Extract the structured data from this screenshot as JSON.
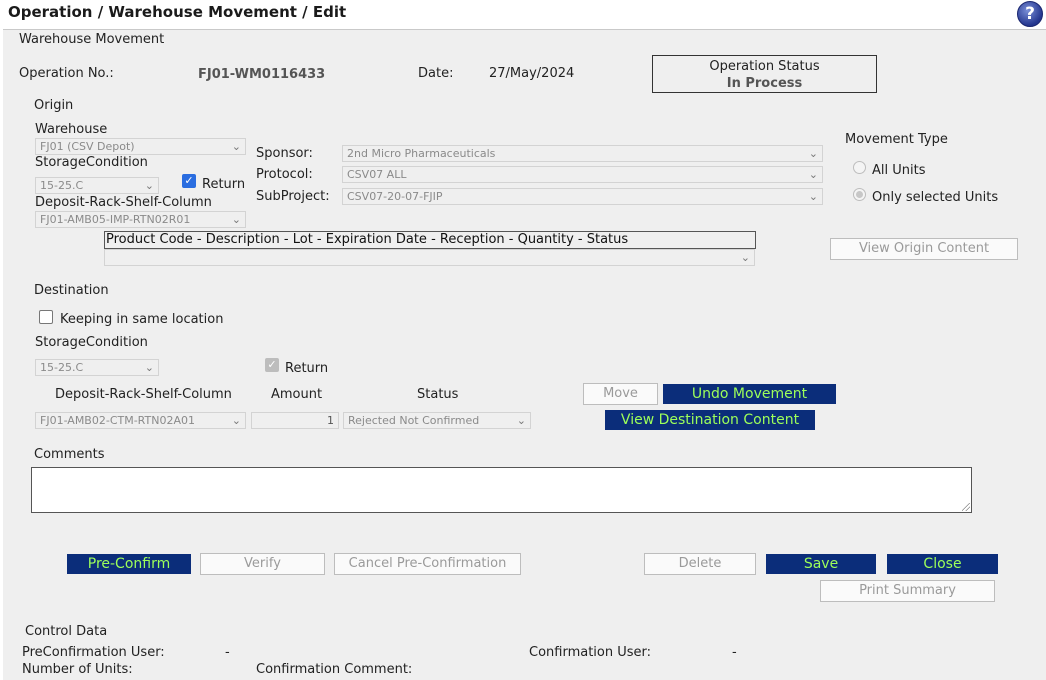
{
  "title": "Operation / Warehouse Movement / Edit",
  "section_title": "Warehouse Movement",
  "operation_no_label": "Operation No.:",
  "operation_no": "FJ01-WM0116433",
  "date_label": "Date:",
  "date": "27/May/2024",
  "status": {
    "label": "Operation Status",
    "value": "In Process"
  },
  "origin": {
    "heading": "Origin",
    "warehouse_label": "Warehouse",
    "warehouse_value": "FJ01 (CSV Depot)",
    "storage_label": "StorageCondition",
    "storage_value": "15-25.C",
    "return_label": "Return",
    "deposit_label": "Deposit-Rack-Shelf-Column",
    "deposit_value": "FJ01-AMB05-IMP-RTN02R01",
    "sponsor_label": "Sponsor:",
    "sponsor_value": "2nd Micro Pharmaceuticals",
    "protocol_label": "Protocol:",
    "protocol_value": "CSV07 ALL",
    "subproject_label": "SubProject:",
    "subproject_value": "CSV07-20-07-FJIP",
    "product_header": "Product Code - Description - Lot - Expiration Date - Reception - Quantity - Status",
    "view_button": "View Origin Content"
  },
  "movement_type": {
    "label": "Movement Type",
    "option_all": "All Units",
    "option_selected": "Only selected Units"
  },
  "destination": {
    "heading": "Destination",
    "keep_label": "Keeping in same location",
    "storage_label": "StorageCondition",
    "storage_value": "15-25.C",
    "return_label": "Return",
    "deposit_label": "Deposit-Rack-Shelf-Column",
    "amount_label": "Amount",
    "status_label": "Status",
    "deposit_value": "FJ01-AMB02-CTM-RTN02A01",
    "amount_value": "1",
    "status_value": "Rejected Not Confirmed",
    "move_button": "Move",
    "undo_button": "Undo Movement",
    "view_button": "View Destination Content"
  },
  "comments_label": "Comments",
  "buttons": {
    "preconfirm": "Pre-Confirm",
    "verify": "Verify",
    "cancel_preconfirm": "Cancel Pre-Confirmation",
    "delete": "Delete",
    "save": "Save",
    "close": "Close",
    "print_summary": "Print Summary"
  },
  "control": {
    "heading": "Control Data",
    "preconf_user_label": "PreConfirmation User:",
    "preconf_user_value": "-",
    "conf_user_label": "Confirmation User:",
    "conf_user_value": "-",
    "units_label": "Number of Units:",
    "conf_comment_label": "Confirmation Comment:"
  }
}
